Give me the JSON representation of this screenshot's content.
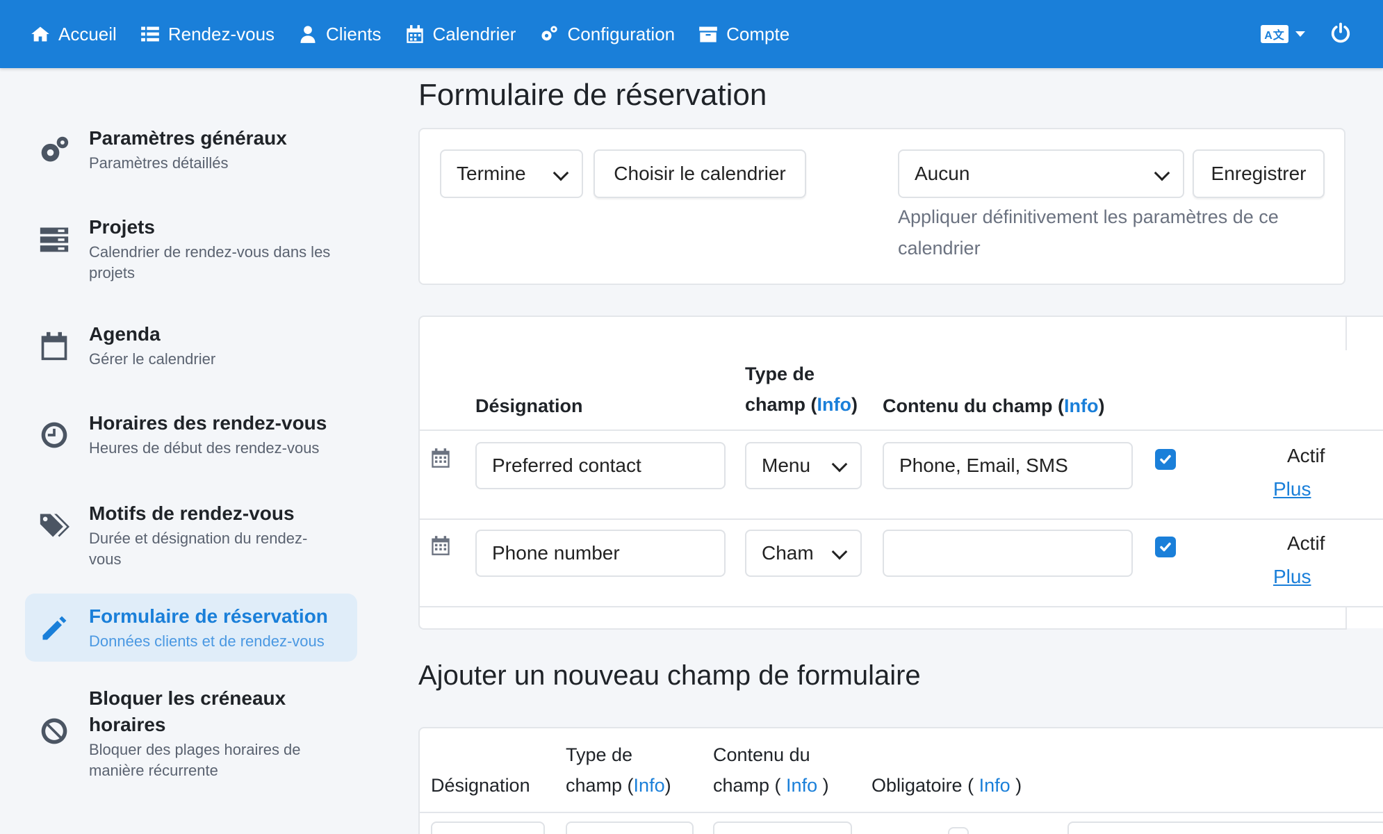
{
  "nav": {
    "items": [
      {
        "label": "Accueil",
        "icon": "home-icon"
      },
      {
        "label": "Rendez-vous",
        "icon": "list-icon"
      },
      {
        "label": "Clients",
        "icon": "user-icon"
      },
      {
        "label": "Calendrier",
        "icon": "calendar-icon"
      },
      {
        "label": "Configuration",
        "icon": "cogs-icon"
      },
      {
        "label": "Compte",
        "icon": "archive-icon"
      }
    ],
    "lang_badge": "A文"
  },
  "sidebar": {
    "items": [
      {
        "title": "Paramètres généraux",
        "sub": "Paramètres détaillés",
        "icon": "cogs-icon"
      },
      {
        "title": "Projets",
        "sub": "Calendrier de rendez-vous dans les projets",
        "icon": "server-icon"
      },
      {
        "title": "Agenda",
        "sub": "Gérer le calendrier",
        "icon": "calendar-icon"
      },
      {
        "title": "Horaires des rendez-vous",
        "sub": "Heures de début des rendez-vous",
        "icon": "clock-icon"
      },
      {
        "title": "Motifs de rendez-vous",
        "sub": "Durée et désignation du rendez-vous",
        "icon": "tags-icon"
      },
      {
        "title": "Formulaire de réservation",
        "sub": "Données clients et de rendez-vous",
        "icon": "pencil-icon",
        "active": true
      },
      {
        "title": "Bloquer les créneaux horaires",
        "sub": "Bloquer des plages horaires de manière récurrente",
        "icon": "ban-icon"
      }
    ]
  },
  "main": {
    "title": "Formulaire de réservation",
    "toolbar": {
      "status_select": "Termine",
      "choose_calendar": "Choisir le calendrier",
      "calendar_select": "Aucun",
      "save": "Enregistrer",
      "hint": "Appliquer définitivement les paramètres de ce calendrier"
    },
    "fields_table": {
      "headers": {
        "designation": "Désignation",
        "type_line1": "Type de",
        "type_line2": "champ (",
        "content": "Contenu du champ (",
        "info": "Info",
        "close": ")"
      },
      "rows": [
        {
          "designation": "Preferred contact",
          "type": "Menu",
          "content": "Phone, Email, SMS",
          "checked": true,
          "status": "Actif",
          "more": "Plus"
        },
        {
          "designation": "Phone number",
          "type": "Cham",
          "content": "",
          "checked": true,
          "status": "Actif",
          "more": "Plus"
        }
      ]
    },
    "new_field": {
      "title": "Ajouter un nouveau champ de formulaire",
      "headers": {
        "designation": "Désignation",
        "type_line1": "Type de",
        "type_line2": "champ  (",
        "content_line1": "Contenu du",
        "content_line2": "champ  ( ",
        "required": "Obligatoire  ( ",
        "info": "Info",
        "close": ")",
        "close_spaced": " )"
      }
    }
  },
  "colors": {
    "accent": "#1a7fd9",
    "background": "#f4f6f9",
    "active_bg": "#e0edf9"
  }
}
